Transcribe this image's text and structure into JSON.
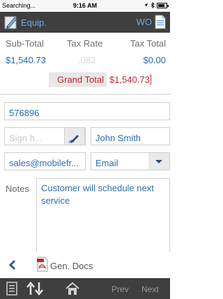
{
  "status_bar": {
    "carrier": "Searching...",
    "time": "9:16 AM"
  },
  "header": {
    "left_label": "Equip.",
    "right_label": "WO"
  },
  "totals": {
    "headers": [
      "Sub-Total",
      "Tax Rate",
      "Tax Total"
    ],
    "subtotal": "$1,540.73",
    "tax_rate": ".082",
    "tax_total": "$0.00",
    "grand_total_label": "Grand Total",
    "grand_total_value": "$1,540.73"
  },
  "fields": {
    "phone_value": "576896",
    "signature_placeholder": "Sign h...",
    "name_value": "John Smith",
    "email_value": "sales@mobilefr...",
    "contact_method_value": "Email"
  },
  "notes": {
    "label": "Notes",
    "value": "Customer will schedule next service"
  },
  "bottom_nav": {
    "gen_docs_label": "Gen. Docs"
  },
  "toolbar": {
    "prev_label": "Prev",
    "next_label": "Next"
  },
  "colors": {
    "header_bg": "#3f3f3f",
    "accent_blue": "#2d6fb0",
    "grand_total_red": "#c0282d"
  }
}
